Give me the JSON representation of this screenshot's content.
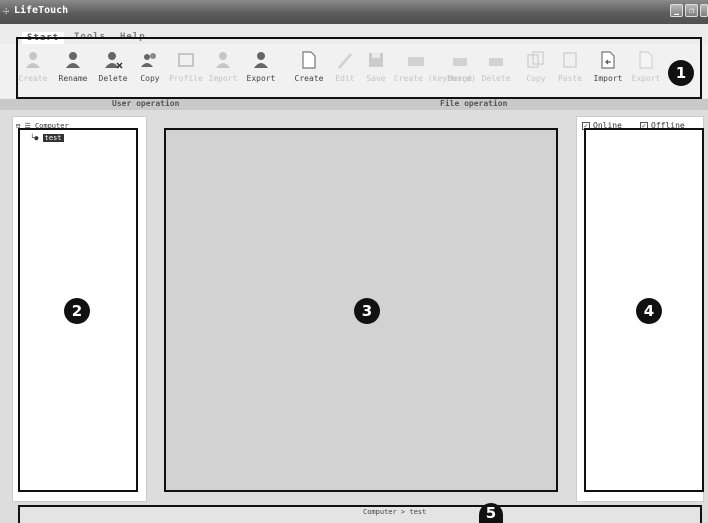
{
  "window": {
    "title": "LifeTouch",
    "app_icon": "usb-icon",
    "buttons": [
      "minimize",
      "restore",
      "close"
    ]
  },
  "menu": {
    "tabs": [
      {
        "label": "Start",
        "active": true
      },
      {
        "label": "Tools"
      },
      {
        "label": "Help"
      }
    ]
  },
  "toolbar": {
    "user_group_label": "User operation",
    "file_group_label": "File operation",
    "buttons": [
      {
        "label": "Create",
        "icon": "user-add-icon",
        "enabled": false
      },
      {
        "label": "Rename",
        "icon": "user-rename-icon",
        "enabled": true
      },
      {
        "label": "Delete",
        "icon": "user-delete-icon",
        "enabled": true
      },
      {
        "label": "Copy",
        "icon": "user-copy-icon",
        "enabled": true
      },
      {
        "label": "Profile",
        "icon": "profile-icon",
        "enabled": false
      },
      {
        "label": "Import",
        "icon": "user-import-icon",
        "enabled": false
      },
      {
        "label": "Export",
        "icon": "user-export-icon",
        "enabled": true
      },
      {
        "label": "Create",
        "icon": "file-create-icon",
        "enabled": true
      },
      {
        "label": "Edit",
        "icon": "file-edit-icon",
        "enabled": false
      },
      {
        "label": "Save",
        "icon": "save-icon",
        "enabled": false
      },
      {
        "label": "Create (keyboard)",
        "icon": "keyboard-create-icon",
        "enabled": false
      },
      {
        "label": "Merge",
        "icon": "merge-icon",
        "enabled": false
      },
      {
        "label": "Delete",
        "icon": "file-delete-icon",
        "enabled": false
      },
      {
        "label": "Copy",
        "icon": "file-copy-icon",
        "enabled": false
      },
      {
        "label": "Paste",
        "icon": "paste-icon",
        "enabled": false
      },
      {
        "label": "Import",
        "icon": "file-import-icon",
        "enabled": true
      },
      {
        "label": "Export",
        "icon": "file-export-icon",
        "enabled": false
      }
    ]
  },
  "tree": {
    "root": "Computer",
    "selected": "test"
  },
  "filters": {
    "online": "Online",
    "offline": "Offline"
  },
  "status": {
    "breadcrumb": "Computer > test"
  },
  "callouts": [
    "1",
    "2",
    "3",
    "4",
    "5"
  ],
  "colors": {
    "callout": "#111111",
    "workspace": "#dddddd",
    "center_pane": "#d2d2d2"
  }
}
